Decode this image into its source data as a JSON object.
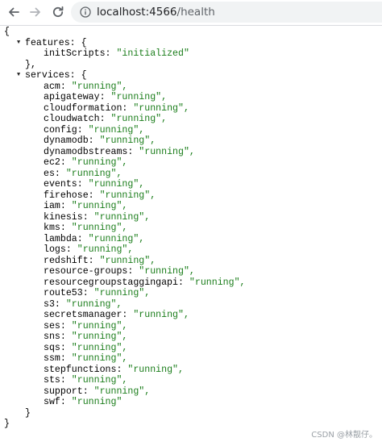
{
  "browser": {
    "url_host": "localhost:4566",
    "url_path": "/health"
  },
  "json": {
    "open_brace": "{",
    "close_brace": "}",
    "features": {
      "key": "features: {",
      "close": "},",
      "entries": [
        {
          "key": "initScripts",
          "value": "\"initialized\""
        }
      ]
    },
    "services": {
      "key": "services: {",
      "close": "}",
      "entries": [
        {
          "key": "acm",
          "value": "\"running\","
        },
        {
          "key": "apigateway",
          "value": "\"running\","
        },
        {
          "key": "cloudformation",
          "value": "\"running\","
        },
        {
          "key": "cloudwatch",
          "value": "\"running\","
        },
        {
          "key": "config",
          "value": "\"running\","
        },
        {
          "key": "dynamodb",
          "value": "\"running\","
        },
        {
          "key": "dynamodbstreams",
          "value": "\"running\","
        },
        {
          "key": "ec2",
          "value": "\"running\","
        },
        {
          "key": "es",
          "value": "\"running\","
        },
        {
          "key": "events",
          "value": "\"running\","
        },
        {
          "key": "firehose",
          "value": "\"running\","
        },
        {
          "key": "iam",
          "value": "\"running\","
        },
        {
          "key": "kinesis",
          "value": "\"running\","
        },
        {
          "key": "kms",
          "value": "\"running\","
        },
        {
          "key": "lambda",
          "value": "\"running\","
        },
        {
          "key": "logs",
          "value": "\"running\","
        },
        {
          "key": "redshift",
          "value": "\"running\","
        },
        {
          "key": "resource-groups",
          "value": "\"running\","
        },
        {
          "key": "resourcegroupstaggingapi",
          "value": "\"running\","
        },
        {
          "key": "route53",
          "value": "\"running\","
        },
        {
          "key": "s3",
          "value": "\"running\","
        },
        {
          "key": "secretsmanager",
          "value": "\"running\","
        },
        {
          "key": "ses",
          "value": "\"running\","
        },
        {
          "key": "sns",
          "value": "\"running\","
        },
        {
          "key": "sqs",
          "value": "\"running\","
        },
        {
          "key": "ssm",
          "value": "\"running\","
        },
        {
          "key": "stepfunctions",
          "value": "\"running\","
        },
        {
          "key": "sts",
          "value": "\"running\","
        },
        {
          "key": "support",
          "value": "\"running\","
        },
        {
          "key": "swf",
          "value": "\"running\""
        }
      ]
    }
  },
  "watermark": "CSDN @林靓仔。",
  "colors": {
    "value_green": "#1a7d1a",
    "omnibox_bg": "#f1f3f4"
  },
  "icons": [
    "back-arrow-icon",
    "forward-arrow-icon",
    "reload-icon",
    "info-icon",
    "collapse-triangle-icon"
  ]
}
